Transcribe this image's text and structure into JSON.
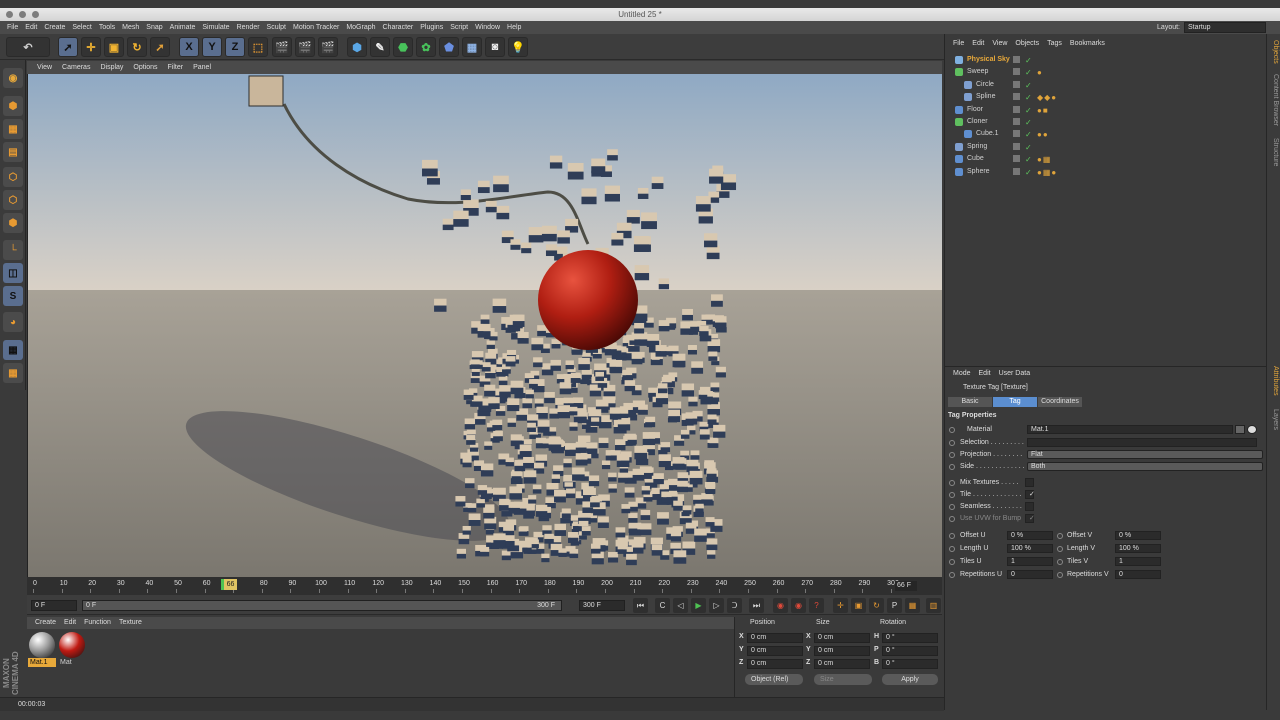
{
  "window": {
    "title": "Untitled 25 *"
  },
  "menubar": {
    "items": [
      "File",
      "Edit",
      "Create",
      "Select",
      "Tools",
      "Mesh",
      "Snap",
      "Animate",
      "Simulate",
      "Render",
      "Sculpt",
      "Motion Tracker",
      "MoGraph",
      "Character",
      "Plugins",
      "Script",
      "Window",
      "Help"
    ],
    "layout_label": "Layout:",
    "layout_value": "Startup"
  },
  "toolbar": {
    "axis_x": "X",
    "axis_y": "Y",
    "axis_z": "Z"
  },
  "left_tools": {
    "s_label": "S"
  },
  "viewport": {
    "menu": [
      "View",
      "Cameras",
      "Display",
      "Options",
      "Filter",
      "Panel"
    ],
    "colors": {
      "sky_top": "#8fa9c4",
      "sky_horizon": "#d9d1c6",
      "ground": "#7b776f",
      "sphere": "#b01e12",
      "cube_light": "#d8c8b0",
      "cube_dark": "#2f3d57"
    }
  },
  "timeline": {
    "ticks": [
      "0",
      "10",
      "20",
      "30",
      "40",
      "50",
      "60",
      "",
      "80",
      "90",
      "100",
      "110",
      "120",
      "130",
      "140",
      "150",
      "160",
      "170",
      "180",
      "190",
      "200",
      "210",
      "220",
      "230",
      "240",
      "250",
      "260",
      "270",
      "280",
      "290",
      "300"
    ],
    "current_frame": "66",
    "end_label": "66 F"
  },
  "transport": {
    "start_field": "0 F",
    "range_start": "0 F",
    "range_end": "300 F",
    "end_field": "300 F"
  },
  "material_manager": {
    "menu": [
      "Create",
      "Edit",
      "Function",
      "Texture"
    ],
    "materials": [
      {
        "name": "Mat.1",
        "color": "#9a9a9a",
        "selected": true
      },
      {
        "name": "Mat",
        "color": "#c01a12",
        "selected": false
      }
    ]
  },
  "coordinates": {
    "headers": {
      "position": "Position",
      "size": "Size",
      "rotation": "Rotation"
    },
    "rows": [
      {
        "axis": "X",
        "pos": "0 cm",
        "size_axis": "X",
        "size": "0 cm",
        "rot_axis": "H",
        "rot": "0 °"
      },
      {
        "axis": "Y",
        "pos": "0 cm",
        "size_axis": "Y",
        "size": "0 cm",
        "rot_axis": "P",
        "rot": "0 °"
      },
      {
        "axis": "Z",
        "pos": "0 cm",
        "size_axis": "Z",
        "size": "0 cm",
        "rot_axis": "B",
        "rot": "0 °"
      }
    ],
    "mode": "Object (Rel)",
    "size_mode": "Size",
    "apply": "Apply"
  },
  "status": {
    "time": "00:00:03"
  },
  "logo": {
    "text": "MAXON CINEMA 4D"
  },
  "object_manager": {
    "menu": [
      "File",
      "Edit",
      "View",
      "Objects",
      "Tags",
      "Bookmarks"
    ],
    "objects": [
      {
        "name": "Physical Sky",
        "indent": 0,
        "color": "#e8a93a",
        "icon_color": "#7fb0e0",
        "tags": "",
        "active": true
      },
      {
        "name": "Sweep",
        "indent": 0,
        "color": "#d0d0d0",
        "icon_color": "#5fbf5f",
        "tags": "●",
        "active": false
      },
      {
        "name": "Circle",
        "indent": 1,
        "color": "#d0d0d0",
        "icon_color": "#7f9fd0",
        "tags": "",
        "active": false
      },
      {
        "name": "Spline",
        "indent": 1,
        "color": "#d0d0d0",
        "icon_color": "#7f9fd0",
        "tags": "◆◆●",
        "active": false
      },
      {
        "name": "Floor",
        "indent": 0,
        "color": "#d0d0d0",
        "icon_color": "#5f8fd0",
        "tags": "●■",
        "active": false
      },
      {
        "name": "Cloner",
        "indent": 0,
        "color": "#d0d0d0",
        "icon_color": "#5fbf5f",
        "tags": "",
        "active": false
      },
      {
        "name": "Cube.1",
        "indent": 1,
        "color": "#d0d0d0",
        "icon_color": "#5f8fd0",
        "tags": "●●",
        "active": false
      },
      {
        "name": "Spring",
        "indent": 0,
        "color": "#d0d0d0",
        "icon_color": "#7f9fd0",
        "tags": "",
        "active": false
      },
      {
        "name": "Cube",
        "indent": 0,
        "color": "#d0d0d0",
        "icon_color": "#5f8fd0",
        "tags": "●▦",
        "active": false
      },
      {
        "name": "Sphere",
        "indent": 0,
        "color": "#d0d0d0",
        "icon_color": "#5f8fd0",
        "tags": "●▦●",
        "active": false
      }
    ]
  },
  "attribute_manager": {
    "menu": [
      "Mode",
      "Edit",
      "User Data"
    ],
    "title": "Texture Tag [Texture]",
    "tabs": [
      {
        "label": "Basic",
        "active": false
      },
      {
        "label": "Tag",
        "active": true
      },
      {
        "label": "Coordinates",
        "active": false
      }
    ],
    "section": "Tag Properties",
    "props": [
      {
        "label": "Material",
        "value": "Mat.1"
      },
      {
        "label": "Selection . . . . . . . . .",
        "value": ""
      },
      {
        "label": "Projection . . . . . . . .",
        "value": "Flat"
      },
      {
        "label": "Side . . . . . . . . . . . . .",
        "value": "Both"
      }
    ],
    "checks": [
      {
        "label": "Mix Textures . . . . .",
        "value": ""
      },
      {
        "label": "Tile . . . . . . . . . . . . .",
        "value": "✓"
      },
      {
        "label": "Seamless . . . . . . . .",
        "value": ""
      },
      {
        "label": "Use UVW for Bump",
        "value": "✓"
      }
    ],
    "pairs": [
      {
        "l1": "Offset U",
        "v1": "0 %",
        "l2": "Offset V",
        "v2": "0 %"
      },
      {
        "l1": "Length U",
        "v1": "100 %",
        "l2": "Length V",
        "v2": "100 %"
      },
      {
        "l1": "Tiles U",
        "v1": "1",
        "l2": "Tiles V",
        "v2": "1"
      },
      {
        "l1": "Repetitions U",
        "v1": "0",
        "l2": "Repetitions V",
        "v2": "0"
      }
    ]
  },
  "side_tabs": [
    "Objects",
    "Content Browser",
    "Structure",
    "Attributes",
    "Layers"
  ]
}
